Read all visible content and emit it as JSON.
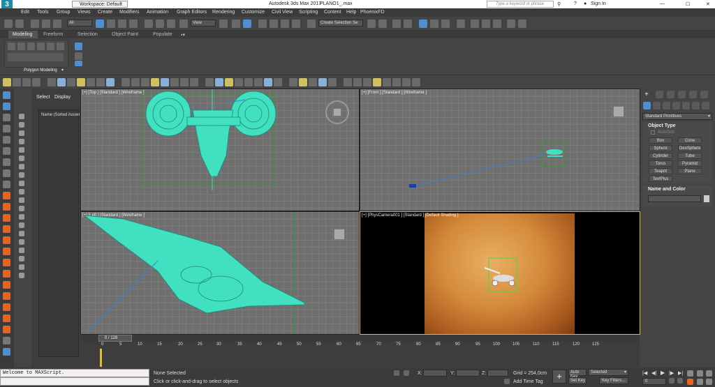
{
  "titlebar": {
    "app_title": "Autodesk 3ds Max 2017",
    "file_name": "PLANO1_.max",
    "workspace": "Workspace: Default",
    "search_placeholder": "Type a keyword or phrase",
    "sign_in": "Sign In"
  },
  "menu": [
    "Edit",
    "Tools",
    "Group",
    "Views",
    "Create",
    "Modifiers",
    "Animation",
    "Graph Editors",
    "Rendering",
    "Customize",
    "Civil View",
    "Scripting",
    "Content",
    "Help",
    "PhoenixFD"
  ],
  "toolbar": {
    "filter": "All",
    "ref_coord": "View",
    "selection_set": "Create Selection Se"
  },
  "ribbon": {
    "tabs": [
      "Modeling",
      "Freeform",
      "Selection",
      "Object Paint",
      "Populate"
    ],
    "panel_label": "Polygon Modeling"
  },
  "explorer": {
    "tabs": [
      "Select",
      "Display"
    ],
    "column_header": "Name (Sorted Ascen"
  },
  "viewports": {
    "top": "[+] [Top ] [Standard ] [Wireframe ]",
    "front": "[+] [Front ] [Standard ] [Wireframe ]",
    "left": "[+] [Left ] [Standard ] [Wireframe ]",
    "camera": "[+] [PhysCamera001 ] [Standard ] [Default Shading ]"
  },
  "command_panel": {
    "category": "Standard Primitives",
    "object_type_title": "Object Type",
    "autogrid": "AutoGrid",
    "buttons": [
      "Box",
      "Cone",
      "Sphere",
      "GeoSphere",
      "Cylinder",
      "Tube",
      "Torus",
      "Pyramid",
      "Teapot",
      "Plane",
      "TextPlus"
    ],
    "name_color_title": "Name and Color"
  },
  "timeline": {
    "frame_display": "0 / 128",
    "ticks": [
      "0",
      "5",
      "10",
      "15",
      "20",
      "25",
      "30",
      "35",
      "40",
      "45",
      "50",
      "55",
      "60",
      "65",
      "70",
      "75",
      "80",
      "85",
      "90",
      "95",
      "100",
      "105",
      "110",
      "115",
      "120",
      "125"
    ]
  },
  "status": {
    "maxscript": "Welcome to MAXScript.",
    "selection": "None Selected",
    "prompt": "Click or click-and-drag to select objects",
    "x_label": "X:",
    "y_label": "Y:",
    "z_label": "Z:",
    "grid": "Grid = 254,0cm",
    "add_time_tag": "Add Time Tag",
    "auto_key": "Auto Key",
    "set_key": "Set Key",
    "selected": "Selected",
    "key_filters": "Key Filters...",
    "frame_value": "0"
  },
  "colors": {
    "wire": "#40e0c0",
    "accent_orange": "#e8641e",
    "highlight_blue": "#4d8fd1"
  }
}
